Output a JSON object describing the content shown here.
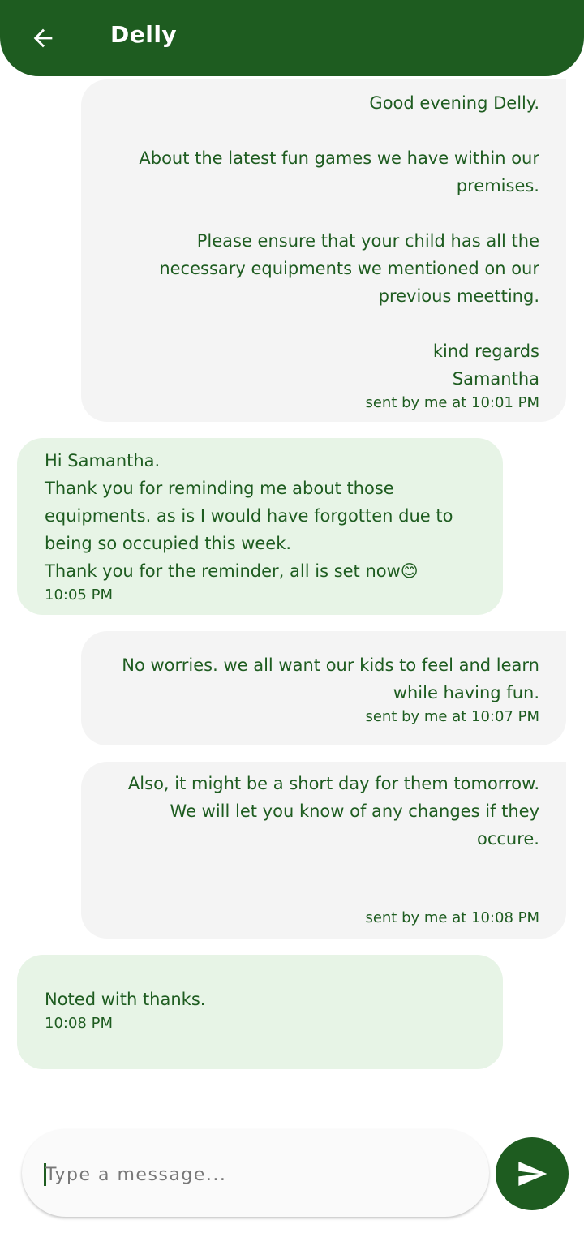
{
  "header": {
    "title": "Delly"
  },
  "messages": [
    {
      "type": "sent",
      "text": "Good evening Delly.\n\nAbout the latest fun games we have within our premises.\n\nPlease ensure that your child has all the necessary equipments we mentioned on our previous meetting.\n\nkind regards\nSamantha",
      "time": "sent by me at 10:01 PM"
    },
    {
      "type": "received",
      "text": "Hi Samantha.\nThank you for reminding me about those equipments. as is I would have forgotten due to being so occupied this week.\nThank you for the reminder, all is set now😊",
      "time": "10:05 PM"
    },
    {
      "type": "sent",
      "text": "No worries. we all want our kids to feel and learn while having fun.",
      "time": "sent by me at 10:07 PM"
    },
    {
      "type": "sent",
      "text": "Also, it might be a short day for them tomorrow. We will let you know of any changes if they occure.",
      "time": "sent by me at 10:08 PM"
    },
    {
      "type": "received",
      "text": "Noted with thanks.",
      "time": "10:08 PM"
    }
  ],
  "composer": {
    "placeholder": "Type a message...",
    "value": ""
  },
  "icons": {
    "back": "arrow-back-icon",
    "send": "send-icon"
  },
  "colors": {
    "primary": "#1e5c20",
    "sent_bubble": "#f4f4f4",
    "received_bubble": "#e7f4e6"
  }
}
